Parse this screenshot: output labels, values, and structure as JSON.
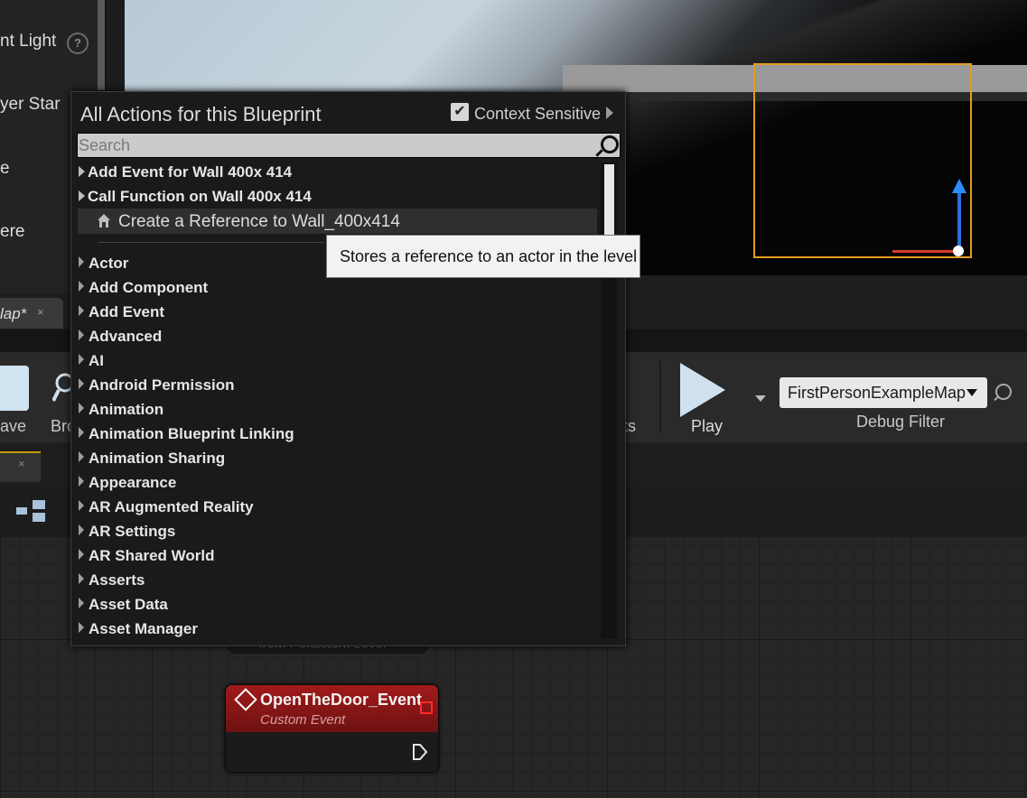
{
  "left_panel": {
    "items": [
      {
        "label": "nt Light"
      },
      {
        "label": "yer Star"
      },
      {
        "label": "e"
      },
      {
        "label": "ere"
      }
    ],
    "help_glyph": "?"
  },
  "tab": {
    "label": "lap*",
    "close": "×"
  },
  "toolbar": {
    "save_label": "ave",
    "browse_label": "Bro",
    "ts_label": "ts",
    "play_label": "Play",
    "debug_filter_value": "FirstPersonExampleMap",
    "debug_filter_label": "Debug Filter"
  },
  "graph_tab": {
    "close": "×"
  },
  "action_menu": {
    "title": "All Actions for this Blueprint",
    "context_sensitive_label": "Context Sensitive",
    "context_sensitive_checked": true,
    "check_glyph": "✔",
    "search_placeholder": "Search",
    "top_items": [
      {
        "label": "Add Event for Wall 400x 414"
      },
      {
        "label": "Call Function on Wall 400x 414"
      }
    ],
    "highlighted_item": "Create a Reference to Wall_400x414",
    "categories": [
      {
        "label": "Actor"
      },
      {
        "label": "Add Component"
      },
      {
        "label": "Add Event"
      },
      {
        "label": "Advanced"
      },
      {
        "label": "AI"
      },
      {
        "label": "Android Permission"
      },
      {
        "label": "Animation"
      },
      {
        "label": "Animation Blueprint Linking"
      },
      {
        "label": "Animation Sharing"
      },
      {
        "label": "Appearance"
      },
      {
        "label": "AR Augmented Reality"
      },
      {
        "label": "AR Settings"
      },
      {
        "label": "AR Shared World"
      },
      {
        "label": "Asserts"
      },
      {
        "label": "Asset Data"
      },
      {
        "label": "Asset Manager"
      }
    ]
  },
  "tooltip": {
    "text": "Stores a reference to an actor in the level"
  },
  "nodes": {
    "hidden_node_text": "from Persistent Level",
    "event_title": "OpenTheDoor_Event",
    "event_subtitle": "Custom Event"
  },
  "colors": {
    "selection": "#e39b1d",
    "event_node_header": "#a21a1a",
    "gizmo_z": "#2b6fd8",
    "gizmo_x": "#d83b2a"
  }
}
